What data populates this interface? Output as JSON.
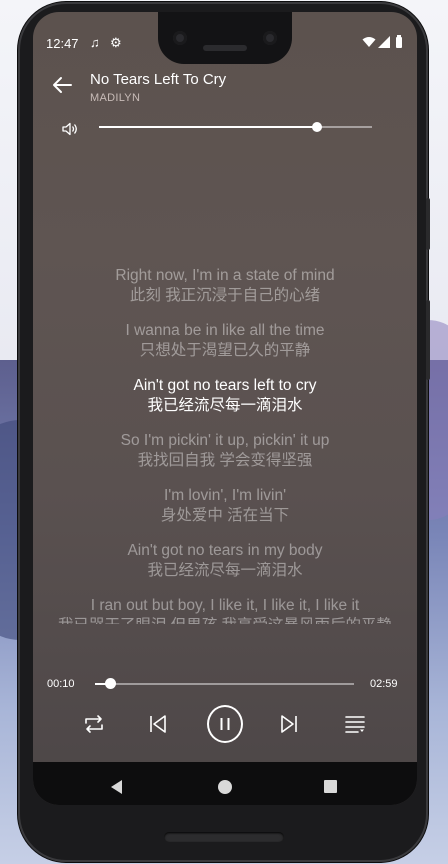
{
  "status_bar": {
    "time": "12:47",
    "music_icon": "♫",
    "settings_icon": "⚙"
  },
  "header": {
    "title": "No Tears Left To Cry",
    "artist": "MADILYN"
  },
  "volume": {
    "level": 0.8
  },
  "lyrics": [
    {
      "en": "Right now, I'm in a state of mind",
      "zh": "此刻 我正沉浸于自己的心绪",
      "current": false
    },
    {
      "en": "I wanna be in like all the time",
      "zh": "只想处于渴望已久的平静",
      "current": false
    },
    {
      "en": "Ain't got no tears left to cry",
      "zh": "我已经流尽每一滴泪水",
      "current": true
    },
    {
      "en": "So I'm pickin' it up, pickin' it up",
      "zh": "我找回自我 学会变得坚强",
      "current": false
    },
    {
      "en": "I'm lovin', I'm livin'",
      "zh": "身处爱中 活在当下",
      "current": false
    },
    {
      "en": "Ain't got no tears in my body",
      "zh": "我已经流尽每一滴泪水",
      "current": false
    },
    {
      "en": "I ran out but boy, I like it, I like it, I like it",
      "zh": "我已哭干了眼泪 但男孩 我享受这暴风雨后的平静",
      "current": false
    }
  ],
  "playback": {
    "elapsed": "00:10",
    "duration": "02:59",
    "progress": 0.056
  },
  "colors": {
    "accent": "#ffffff",
    "background": "#5c524e",
    "navbar": "#0d0d0e"
  }
}
